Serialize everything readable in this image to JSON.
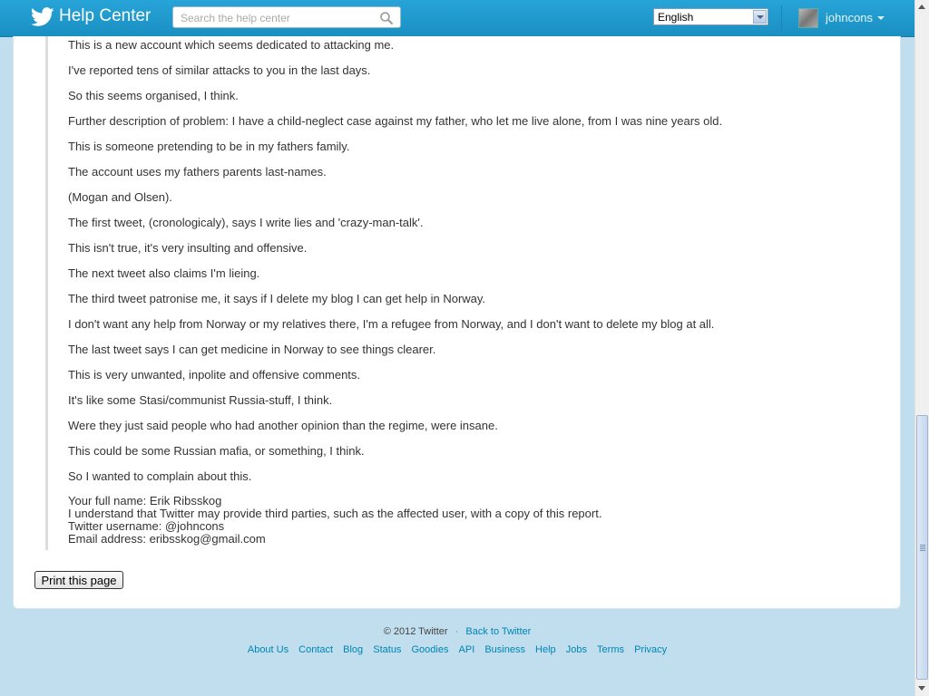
{
  "header": {
    "brand": "Help Center",
    "search_placeholder": "Search the help center",
    "language": "English",
    "username": "johncons"
  },
  "report": {
    "lines": [
      "This is a new account which seems dedicated to attacking me.",
      "I've reported tens of similar attacks to you in the last days.",
      "So this seems organised, I think.",
      "Further description of problem: I have a child-neglect case against my father, who let me live alone, from I was nine years old.",
      "This is someone pretending to be in my fathers family.",
      "The account uses my fathers parents last-names.",
      "(Mogan and Olsen).",
      "The first tweet, (cronologicaly), says I write lies and 'crazy-man-talk'.",
      "This isn't true, it's very insulting and offensive.",
      "The next tweet also claims I'm lieing.",
      "The third tweet patronise me, it says if I delete my blog I can get help in Norway.",
      "I don't want any help from Norway or my relatives there, I'm a refugee from Norway, and I don't want to delete my blog at all.",
      "The last tweet says I can get medicine in Norway to see things clearer.",
      "This is very unwanted, inpolite and offensive comments.",
      "It's like some Stasi/communist Russia-stuff, I think.",
      "Were they just said people who had another opinion than the regime, were insane.",
      "This could be some Russian mafia, or something, I think.",
      "So I wanted to complain about this."
    ],
    "summary": [
      "Your full name: Erik Ribsskog",
      "I understand that Twitter may provide third parties, such as the affected user, with a copy of this report.",
      "Twitter username: @johncons",
      "Email address: eribsskog@gmail.com"
    ]
  },
  "print_button": "Print this page",
  "footer": {
    "copyright": "© 2012 Twitter",
    "separator": "·",
    "back_link": "Back to Twitter",
    "links": [
      "About Us",
      "Contact",
      "Blog",
      "Status",
      "Goodies",
      "API",
      "Business",
      "Help",
      "Jobs",
      "Terms",
      "Privacy"
    ]
  },
  "colors": {
    "topbar": "#1a8fc2",
    "background": "#c0deed",
    "link": "#0084b4"
  }
}
